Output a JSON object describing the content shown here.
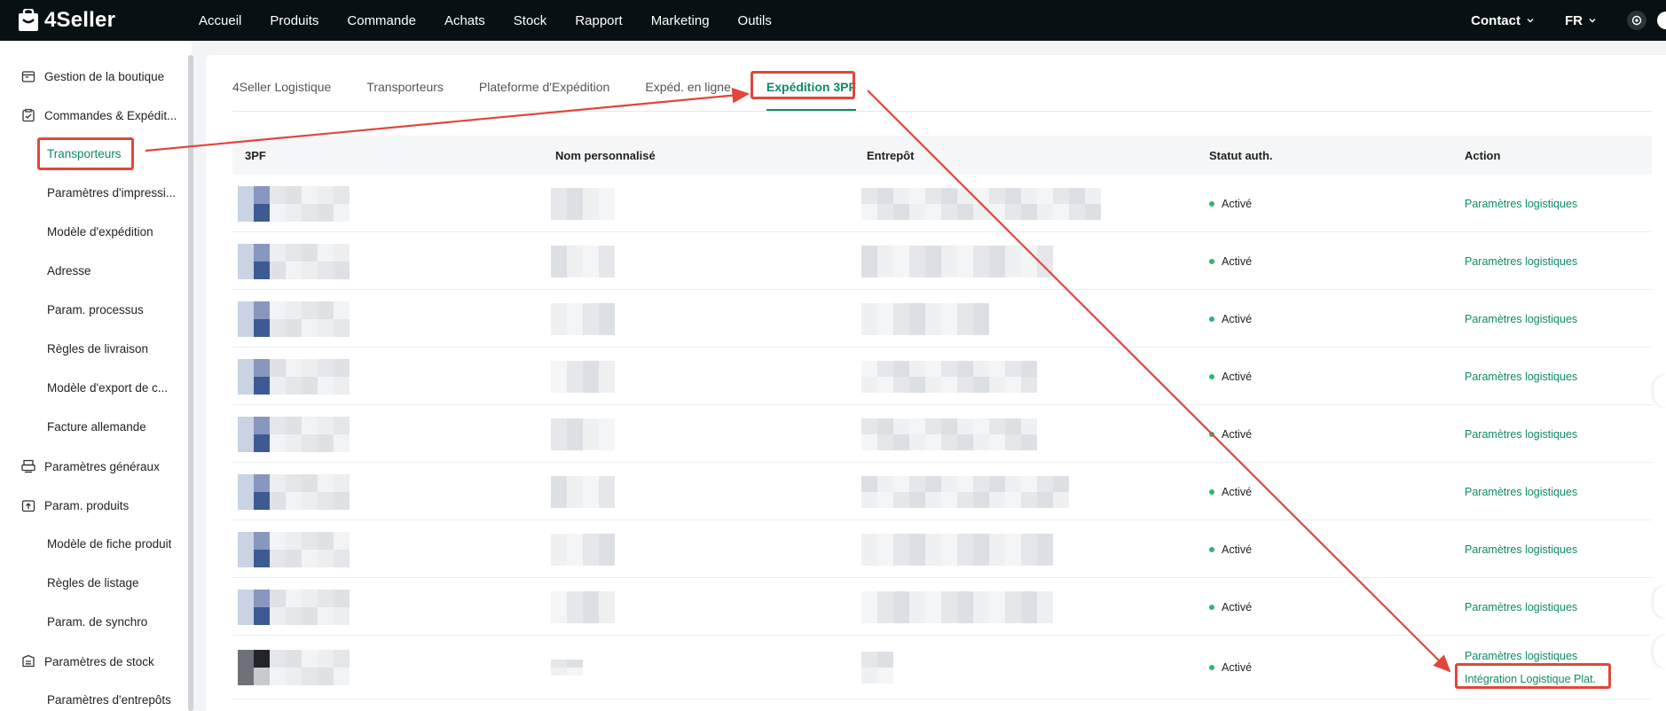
{
  "app": {
    "logo_text": "4Seller"
  },
  "topnav": {
    "items": [
      "Accueil",
      "Produits",
      "Commande",
      "Achats",
      "Stock",
      "Rapport",
      "Marketing",
      "Outils"
    ],
    "contact": "Contact",
    "language": "FR"
  },
  "sidebar": {
    "items": [
      "Gestion de la boutique",
      "Commandes & Expédit...",
      "Transporteurs",
      "Paramètres d'impressi...",
      "Modèle d'expédition",
      "Adresse",
      "Param. processus",
      "Règles de livraison",
      "Modèle d'export de c...",
      "Facture allemande",
      "Paramètres généraux",
      "Param. produits",
      "Modèle de fiche produit",
      "Règles de listage",
      "Param. de synchro",
      "Paramètres de stock",
      "Paramètres d'entrepôts"
    ],
    "active": "Transporteurs"
  },
  "tabs": [
    "4Seller Logistique",
    "Transporteurs",
    "Plateforme d'Expédition",
    "Expéd. en ligne",
    "Expédition 3PF"
  ],
  "active_tab": "Expédition 3PF",
  "table": {
    "headers": [
      "3PF",
      "Nom personnalisé",
      "Entrepôt",
      "Statut auth.",
      "Action"
    ],
    "rows": [
      {
        "status": "Activé",
        "action": "Paramètres logistiques"
      },
      {
        "status": "Activé",
        "action": "Paramètres logistiques"
      },
      {
        "status": "Activé",
        "action": "Paramètres logistiques"
      },
      {
        "status": "Activé",
        "action": "Paramètres logistiques"
      },
      {
        "status": "Activé",
        "action": "Paramètres logistiques"
      },
      {
        "status": "Activé",
        "action": "Paramètres logistiques"
      },
      {
        "status": "Activé",
        "action": "Paramètres logistiques"
      },
      {
        "status": "Activé",
        "action": "Paramètres logistiques"
      },
      {
        "status": "Activé",
        "action": "Paramètres logistiques",
        "action2": "Intégration Logistique Plat."
      }
    ]
  },
  "colors": {
    "accent": "#0e8a68",
    "topbar": "#071113",
    "annotation": "#e0463b",
    "status": "#2bb673"
  }
}
